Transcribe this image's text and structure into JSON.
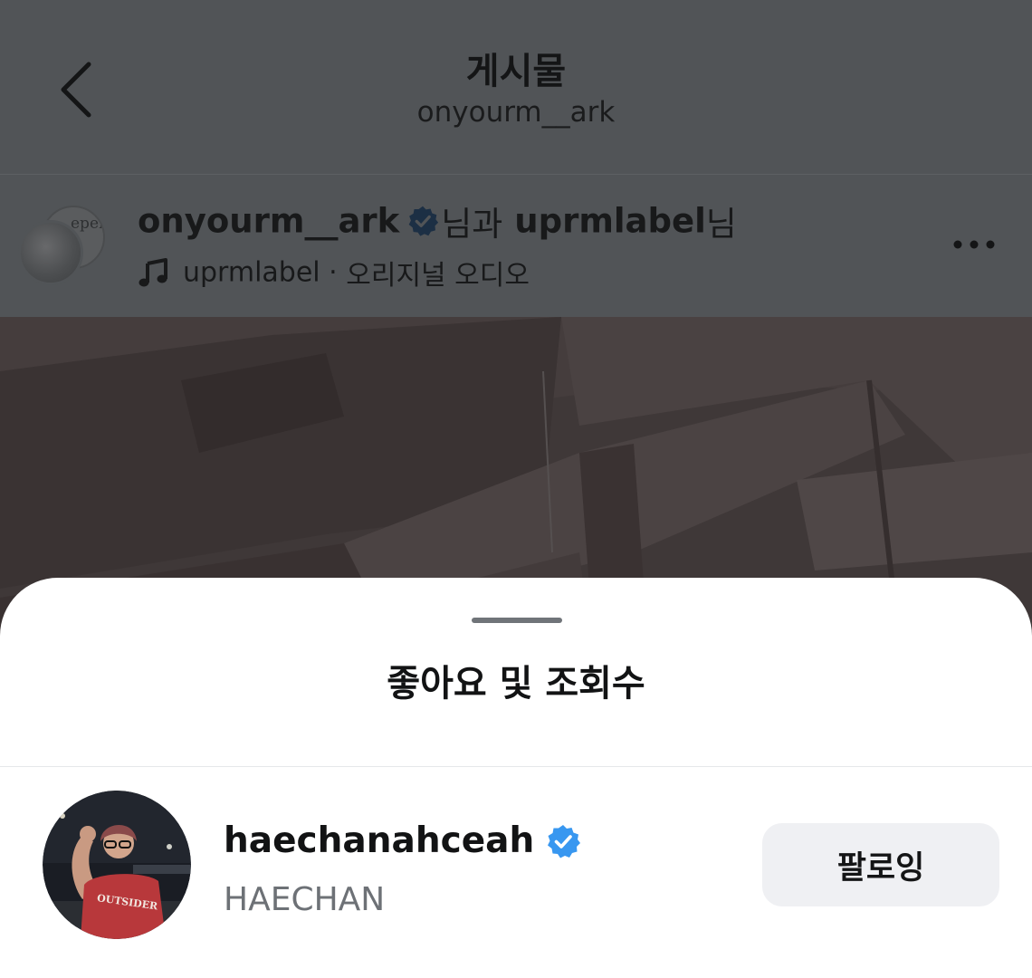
{
  "header": {
    "title": "게시물",
    "subtitle": "onyourm__ark"
  },
  "post": {
    "author": "onyourm__ark",
    "suffix_1": "님과",
    "collaborator": "uprmlabel",
    "suffix_2": "님",
    "audio_owner": "uprmlabel",
    "audio_separator": " · ",
    "audio_title": "오리지널 오디오",
    "avatar_back_text": "eper\nn"
  },
  "sheet": {
    "title": "좋아요 및 조회수"
  },
  "user": {
    "username": "haechanahceah",
    "full_name": "HAECHAN",
    "shirt_text": "OUTSIDER",
    "follow_label": "팔로잉"
  },
  "colors": {
    "verified": "#3897f0",
    "dim_overlay": "#515457",
    "follow_bg": "#eff0f3",
    "secondary_text": "#6d7176"
  },
  "icons": {
    "back": "chevron-left-icon",
    "verified": "verified-badge-icon",
    "audio": "music-note-icon",
    "more": "more-horizontal-icon"
  }
}
